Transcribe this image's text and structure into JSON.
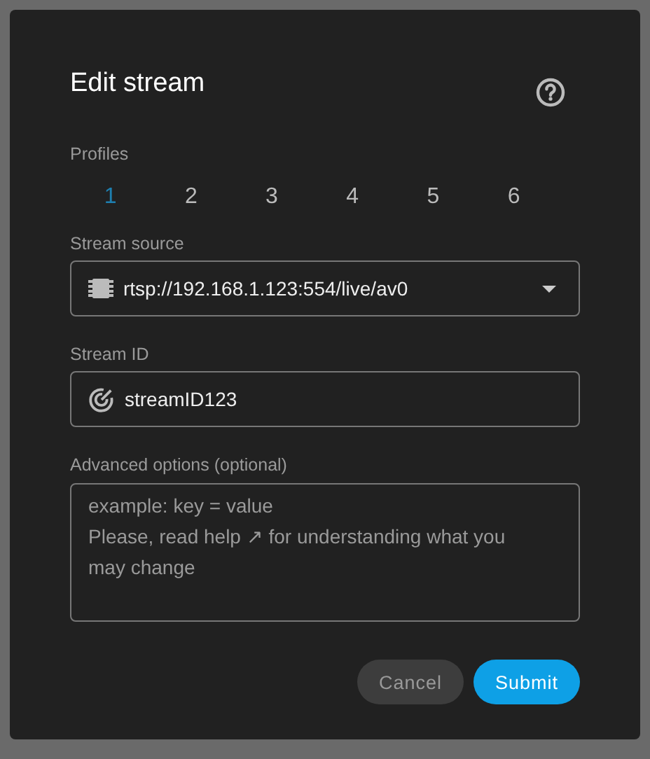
{
  "dialog": {
    "title": "Edit stream"
  },
  "profiles": {
    "label": "Profiles",
    "tabs": [
      {
        "label": "1",
        "selected": true
      },
      {
        "label": "2",
        "selected": false
      },
      {
        "label": "3",
        "selected": false
      },
      {
        "label": "4",
        "selected": false
      },
      {
        "label": "5",
        "selected": false
      },
      {
        "label": "6",
        "selected": false
      }
    ]
  },
  "stream_source": {
    "label": "Stream source",
    "value": "rtsp://192.168.1.123:554/live/av0"
  },
  "stream_id": {
    "label": "Stream ID",
    "value": "streamID123"
  },
  "advanced_options": {
    "label": "Advanced options (optional)",
    "placeholder": "example: key = value\nPlease, read help ↗ for understanding what you may change"
  },
  "buttons": [
    {
      "label": "Cancel",
      "kind": "secondary"
    },
    {
      "label": "Submit",
      "kind": "primary"
    }
  ]
}
